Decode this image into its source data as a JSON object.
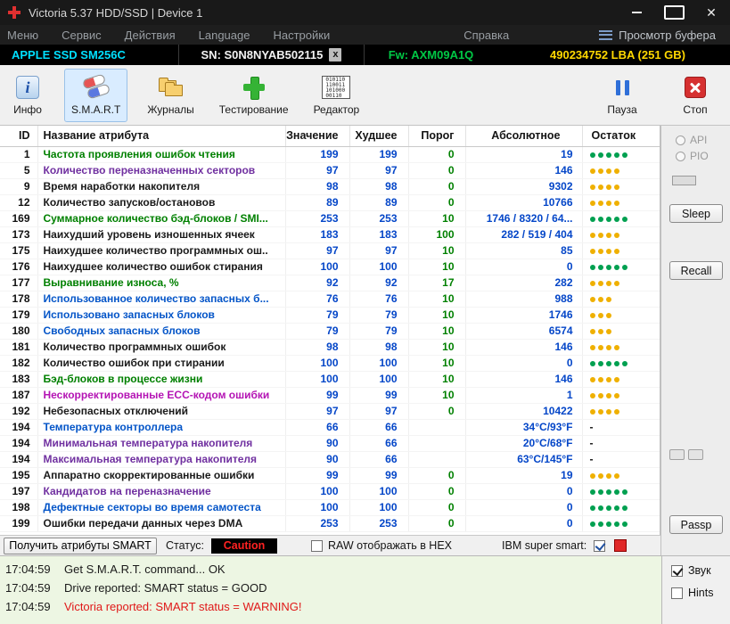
{
  "window": {
    "title": "Victoria 5.37 HDD/SSD | Device 1",
    "close": "✕"
  },
  "menu": {
    "items": [
      "Меню",
      "Сервис",
      "Действия",
      "Language",
      "Настройки",
      "Справка"
    ],
    "buffer_button": "Просмотр буфера"
  },
  "device_bar": {
    "model": "APPLE SSD SM256C",
    "serial": "SN: S0N8NYAB502115",
    "serial_badge": "x",
    "firmware": "Fw: AXM09A1Q",
    "capacity": "490234752 LBA (251 GB)"
  },
  "toolbar": {
    "info": "Инфо",
    "smart": "S.M.A.R.T",
    "journals": "Журналы",
    "testing": "Тестирование",
    "editor": "Редактор",
    "pause": "Пауза",
    "stop": "Стоп",
    "editor_icon_lines": [
      "010110",
      "110011",
      "101000",
      "00110"
    ]
  },
  "table": {
    "headers": [
      "ID",
      "Название атрибута",
      "Значение",
      "Худшее",
      "Порог",
      "Абсолютное",
      "Остаток"
    ],
    "rows": [
      {
        "id": "1",
        "name": "Частота проявления ошибок чтения",
        "name_color": "green",
        "value": "199",
        "worst": "199",
        "threshold": "0",
        "absolute": "19",
        "dots": 5,
        "dot_color": "green"
      },
      {
        "id": "5",
        "name": "Количество переназначенных секторов",
        "name_color": "purple",
        "value": "97",
        "worst": "97",
        "threshold": "0",
        "absolute": "146",
        "dots": 4,
        "dot_color": "yellow"
      },
      {
        "id": "9",
        "name": "Время наработки накопителя",
        "name_color": "black",
        "value": "98",
        "worst": "98",
        "threshold": "0",
        "absolute": "9302",
        "dots": 4,
        "dot_color": "yellow"
      },
      {
        "id": "12",
        "name": "Количество запусков/остановов",
        "name_color": "black",
        "value": "89",
        "worst": "89",
        "threshold": "0",
        "absolute": "10766",
        "dots": 4,
        "dot_color": "yellow"
      },
      {
        "id": "169",
        "name": "Суммарное количество бэд-блоков / SMI...",
        "name_color": "green",
        "value": "253",
        "worst": "253",
        "threshold": "10",
        "absolute": "1746 / 8320 / 64...",
        "dots": 5,
        "dot_color": "green"
      },
      {
        "id": "173",
        "name": "Наихудший уровень изношенных ячеек",
        "name_color": "black",
        "value": "183",
        "worst": "183",
        "threshold": "100",
        "absolute": "282 / 519 / 404",
        "dots": 4,
        "dot_color": "yellow"
      },
      {
        "id": "175",
        "name": "Наихудшее количество программных ош..",
        "name_color": "black",
        "value": "97",
        "worst": "97",
        "threshold": "10",
        "absolute": "85",
        "dots": 4,
        "dot_color": "yellow"
      },
      {
        "id": "176",
        "name": "Наихудшее количество ошибок стирания",
        "name_color": "black",
        "value": "100",
        "worst": "100",
        "threshold": "10",
        "absolute": "0",
        "dots": 5,
        "dot_color": "green"
      },
      {
        "id": "177",
        "name": "Выравнивание износа, %",
        "name_color": "green",
        "value": "92",
        "worst": "92",
        "threshold": "17",
        "absolute": "282",
        "dots": 4,
        "dot_color": "yellow"
      },
      {
        "id": "178",
        "name": "Использованное количество запасных б...",
        "name_color": "blue",
        "value": "76",
        "worst": "76",
        "threshold": "10",
        "absolute": "988",
        "dots": 3,
        "dot_color": "yellow"
      },
      {
        "id": "179",
        "name": "Использовано запасных блоков",
        "name_color": "blue",
        "value": "79",
        "worst": "79",
        "threshold": "10",
        "absolute": "1746",
        "dots": 3,
        "dot_color": "yellow"
      },
      {
        "id": "180",
        "name": "Свободных запасных блоков",
        "name_color": "blue",
        "value": "79",
        "worst": "79",
        "threshold": "10",
        "absolute": "6574",
        "dots": 3,
        "dot_color": "yellow"
      },
      {
        "id": "181",
        "name": "Количество программных ошибок",
        "name_color": "black",
        "value": "98",
        "worst": "98",
        "threshold": "10",
        "absolute": "146",
        "dots": 4,
        "dot_color": "yellow"
      },
      {
        "id": "182",
        "name": "Количество ошибок при стирании",
        "name_color": "black",
        "value": "100",
        "worst": "100",
        "threshold": "10",
        "absolute": "0",
        "dots": 5,
        "dot_color": "green"
      },
      {
        "id": "183",
        "name": "Бэд-блоков в процессе жизни",
        "name_color": "green",
        "value": "100",
        "worst": "100",
        "threshold": "10",
        "absolute": "146",
        "dots": 4,
        "dot_color": "yellow"
      },
      {
        "id": "187",
        "name": "Нескорректированные ECC-кодом ошибки",
        "name_color": "magenta",
        "value": "99",
        "worst": "99",
        "threshold": "10",
        "absolute": "1",
        "dots": 4,
        "dot_color": "yellow"
      },
      {
        "id": "192",
        "name": "Небезопасных отключений",
        "name_color": "black",
        "value": "97",
        "worst": "97",
        "threshold": "0",
        "absolute": "10422",
        "dots": 4,
        "dot_color": "yellow"
      },
      {
        "id": "194",
        "name": "Температура контроллера",
        "name_color": "blue",
        "value": "66",
        "worst": "66",
        "threshold": "",
        "absolute": "34°C/93°F",
        "dots": 0,
        "dot_color": "dash"
      },
      {
        "id": "194",
        "name": "Минимальная температура накопителя",
        "name_color": "purple",
        "value": "90",
        "worst": "66",
        "threshold": "",
        "absolute": "20°C/68°F",
        "dots": 0,
        "dot_color": "dash"
      },
      {
        "id": "194",
        "name": "Максимальная температура накопителя",
        "name_color": "purple",
        "value": "90",
        "worst": "66",
        "threshold": "",
        "absolute": "63°C/145°F",
        "dots": 0,
        "dot_color": "dash"
      },
      {
        "id": "195",
        "name": "Аппаратно скорректированные ошибки",
        "name_color": "black",
        "value": "99",
        "worst": "99",
        "threshold": "0",
        "absolute": "19",
        "dots": 4,
        "dot_color": "yellow"
      },
      {
        "id": "197",
        "name": "Кандидатов на переназначение",
        "name_color": "purple",
        "value": "100",
        "worst": "100",
        "threshold": "0",
        "absolute": "0",
        "dots": 5,
        "dot_color": "green"
      },
      {
        "id": "198",
        "name": "Дефектные секторы во время самотеста",
        "name_color": "blue",
        "value": "100",
        "worst": "100",
        "threshold": "0",
        "absolute": "0",
        "dots": 5,
        "dot_color": "green"
      },
      {
        "id": "199",
        "name": "Ошибки передачи данных через DMA",
        "name_color": "black",
        "value": "253",
        "worst": "253",
        "threshold": "0",
        "absolute": "0",
        "dots": 5,
        "dot_color": "green"
      }
    ]
  },
  "side_panel": {
    "api": "API",
    "pio": "PIO",
    "sleep": "Sleep",
    "recall": "Recall",
    "passp": "Passp"
  },
  "status_bar": {
    "get_smart": "Получить атрибуты SMART",
    "status_label": "Статус:",
    "status_value": "Caution",
    "raw_hex": "RAW отображать в HEX",
    "ibm_label": "IBM super smart:"
  },
  "log": {
    "entries": [
      {
        "time": "17:04:59",
        "message": "Get S.M.A.R.T. command... OK",
        "color": "black"
      },
      {
        "time": "17:04:59",
        "message": "Drive reported: SMART status = GOOD",
        "color": "black"
      },
      {
        "time": "17:04:59",
        "message": "Victoria reported: SMART status = WARNING!",
        "color": "red"
      }
    ]
  },
  "log_side": {
    "sound": "Звук",
    "hints": "Hints"
  },
  "colors": {
    "name_green": "#008000",
    "name_purple": "#7030a0",
    "name_black": "#1a1a1a",
    "name_blue": "#0455c8",
    "name_magenta": "#b414b4",
    "value_blue": "#0446c8",
    "threshold_green": "#008000",
    "dot_green": "#00a050",
    "dot_yellow": "#efb000",
    "log_red": "#e01818",
    "status_caution_bg": "#000000",
    "status_caution_fg": "#ff2222",
    "model_cyan": "#00e0ff",
    "firmware_green": "#00c845",
    "capacity_yellow": "#ffd800",
    "active_tab_bg": "#d9ecff"
  }
}
